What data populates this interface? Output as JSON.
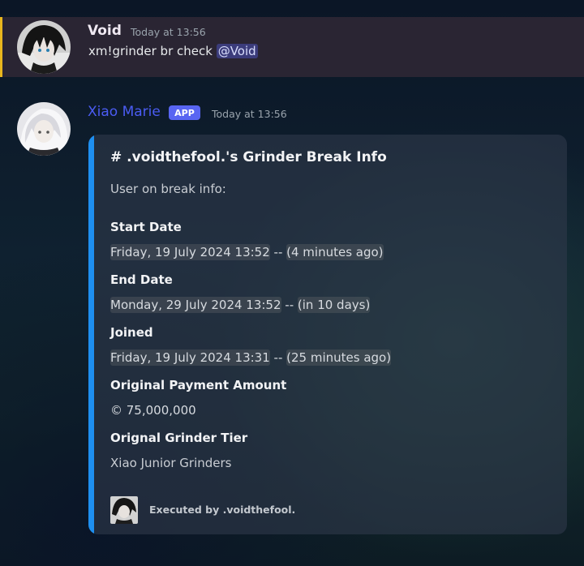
{
  "message1": {
    "author": "Void",
    "timestamp": "Today at 13:56",
    "text": "xm!grinder br check ",
    "mention": "@Void"
  },
  "message2": {
    "author": "Xiao Marie",
    "badge": "APP",
    "timestamp": "Today at 13:56",
    "embed": {
      "title": "# .voidthefool.'s Grinder Break Info",
      "description": "User on break info:",
      "fields": {
        "start": {
          "name": "Start Date",
          "date": "Friday, 19 July 2024 13:52",
          "sep": " -- ",
          "relative": "(4 minutes ago)"
        },
        "end": {
          "name": "End Date",
          "date": "Monday, 29 July 2024 13:52",
          "sep": " -- ",
          "relative": "(in 10 days)"
        },
        "joined": {
          "name": "Joined",
          "date": "Friday, 19 July 2024 13:31",
          "sep": " -- ",
          "relative": "(25 minutes ago)"
        },
        "payment": {
          "name": "Original Payment Amount",
          "value": "© 75,000,000"
        },
        "tier": {
          "name": "Orignal Grinder Tier",
          "value": "Xiao Junior Grinders"
        }
      },
      "footer": "Executed by .voidthefool."
    }
  },
  "colors": {
    "highlight_bar": "#e8b61e",
    "embed_stripe": "#1e8ff0",
    "app_badge": "#5865f2",
    "bot_name": "#4b5cf3"
  }
}
